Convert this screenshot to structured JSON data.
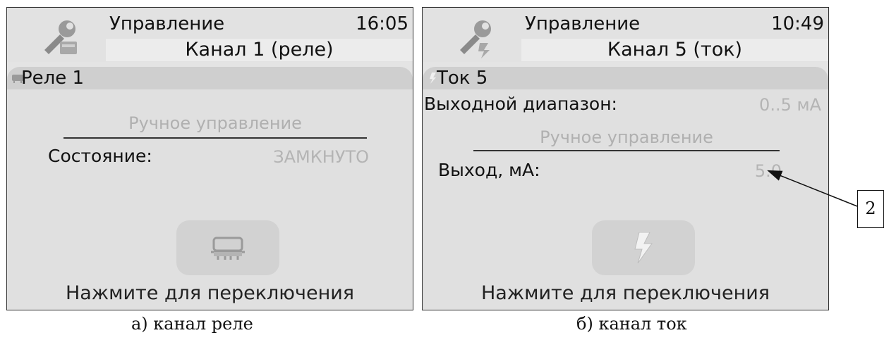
{
  "screens": [
    {
      "header_title": "Управление",
      "time": "16:05",
      "channel_title": "Канал 1 (реле)",
      "channel_name": "Реле 1",
      "mode": "Ручное управление",
      "state_label": "Состояние:",
      "state_value": "ЗАМКНУТО",
      "footer": "Нажмите для переключения",
      "caption": "а) канал реле"
    },
    {
      "header_title": "Управление",
      "time": "10:49",
      "channel_title": "Канал 5 (ток)",
      "channel_name": "Ток 5",
      "range_label": "Выходной диапазон:",
      "range_value": "0..5 мА",
      "mode": "Ручное управление",
      "output_label": "Выход, мА:",
      "output_value": "5.0",
      "footer": "Нажмите для переключения",
      "caption": "б) канал ток"
    }
  ],
  "callout_label": "2",
  "icons": {
    "app": "tools-icon",
    "relay": "relay-icon",
    "current": "lightning-icon"
  }
}
